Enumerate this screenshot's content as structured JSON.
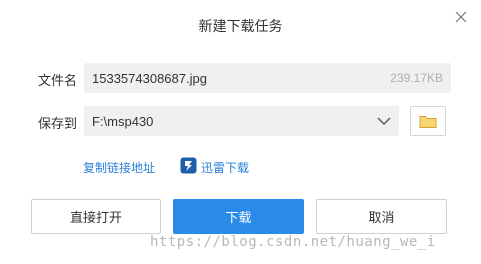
{
  "dialog": {
    "title": "新建下载任务",
    "close_icon": "close-icon"
  },
  "fields": {
    "filename_label": "文件名",
    "filename_value": "1533574308687.jpg",
    "filesize": "239.17KB",
    "saveto_label": "保存到",
    "saveto_value": "F:\\msp430",
    "dropdown_icon": "chevron-down-icon",
    "folder_icon": "folder-icon"
  },
  "links": {
    "copy_link": "复制链接地址",
    "thunder_download": "迅雷下载",
    "thunder_icon": "thunder-icon"
  },
  "buttons": {
    "open_directly": "直接打开",
    "download": "下载",
    "cancel": "取消"
  },
  "watermark": "https://blog.csdn.net/huang_we_i",
  "colors": {
    "accent": "#2a8ae8",
    "link": "#2b7fd8",
    "field_bg": "#f0f0f0",
    "folder": "#f5c542"
  }
}
